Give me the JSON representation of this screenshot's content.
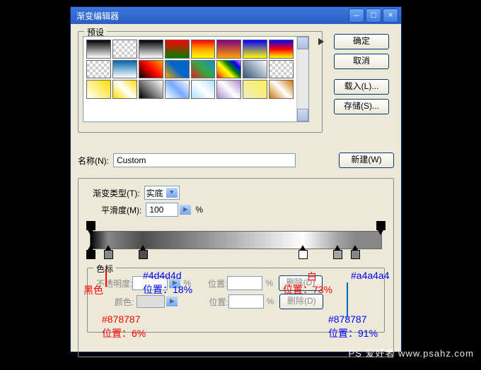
{
  "dialog": {
    "title": "渐变编辑器",
    "buttons": {
      "ok": "确定",
      "cancel": "取消",
      "load": "载入(L)...",
      "save": "存储(S)...",
      "new": "新建(W)"
    }
  },
  "presets": {
    "legend": "预设"
  },
  "nameRow": {
    "label": "名称(N):",
    "value": "Custom"
  },
  "gradientType": {
    "label": "渐变类型(T):",
    "value": "实底"
  },
  "smoothness": {
    "label": "平滑度(M):",
    "value": "100",
    "suffix": "%"
  },
  "stops": {
    "legend": "色标",
    "opacityLabel": "不透明度:",
    "opacitySuffix": "%",
    "locationLabel": "位置:",
    "locationSuffix": "%",
    "deleteLabel": "删除(D)",
    "colorLabel": "颜色:",
    "locationLabel2": "位置:",
    "deleteLabel2": "删除(D)"
  },
  "annotations": {
    "black": "黑色",
    "hex1": "#878787",
    "pos1": "位置：6%",
    "hex2": "#4d4d4d",
    "pos2": "位置：18%",
    "white": "白",
    "pos3": "位置：73%",
    "hex3": "#a4a4a4",
    "hex4": "#878787",
    "pos4": "位置：91%"
  },
  "watermark": "PS 爱好者 www.psahz.com"
}
